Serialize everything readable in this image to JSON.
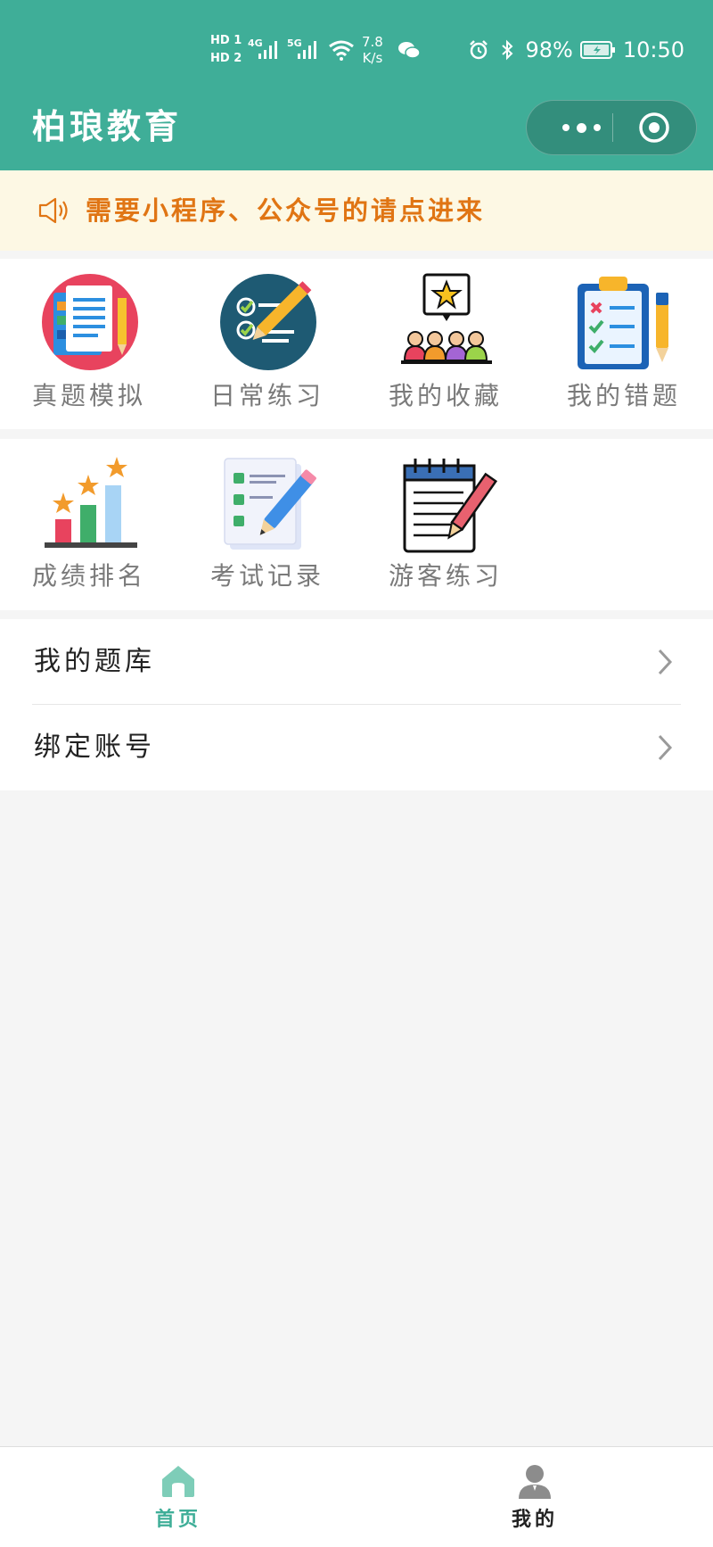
{
  "status_bar": {
    "hd1": "HD 1",
    "hd2": "HD 2",
    "net_4g": "4G",
    "net_5g": "5G",
    "speed_value": "7.8",
    "speed_unit": "K/s",
    "battery_percent": "98%",
    "time": "10:50"
  },
  "nav": {
    "title": "柏琅教育"
  },
  "notice": {
    "text": "需要小程序、公众号的请点进来",
    "color": "#e07514"
  },
  "grid_row1": [
    {
      "label": "真题模拟",
      "icon": "exam-document-icon"
    },
    {
      "label": "日常练习",
      "icon": "checklist-pencil-icon"
    },
    {
      "label": "我的收藏",
      "icon": "favorites-audience-icon"
    },
    {
      "label": "我的错题",
      "icon": "clipboard-mistakes-icon"
    }
  ],
  "grid_row2": [
    {
      "label": "成绩排名",
      "icon": "ranking-bars-icon"
    },
    {
      "label": "考试记录",
      "icon": "exam-record-icon"
    },
    {
      "label": "游客练习",
      "icon": "notepad-pen-icon"
    }
  ],
  "list": [
    {
      "label": "我的题库"
    },
    {
      "label": "绑定账号"
    }
  ],
  "tabbar": {
    "home": {
      "label": "首页",
      "active": true,
      "color": "#3fae98"
    },
    "mine": {
      "label": "我的",
      "active": false,
      "color": "#222222"
    }
  },
  "colors": {
    "brand": "#3fae98",
    "background": "#f5f5f5"
  }
}
